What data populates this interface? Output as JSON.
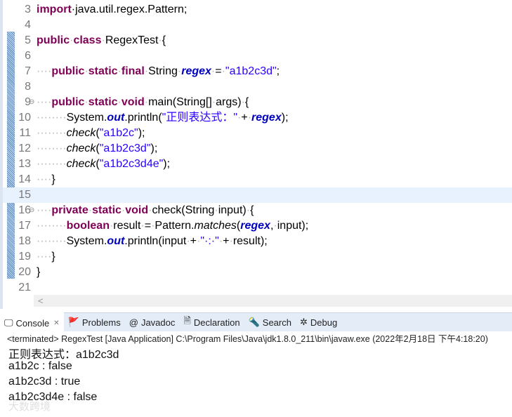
{
  "editor": {
    "current_line": 15,
    "lines": [
      {
        "n": "3",
        "tokens": [
          [
            "import",
            "kw"
          ],
          [
            "·",
            ""
          ],
          [
            "java.util.regex.Pattern;",
            ""
          ]
        ]
      },
      {
        "n": "4",
        "tokens": []
      },
      {
        "n": "5",
        "tokens": [
          [
            "public",
            "kw"
          ],
          [
            "·",
            "ws"
          ],
          [
            "class",
            "kw"
          ],
          [
            "·",
            "ws"
          ],
          [
            "RegexTest",
            ""
          ],
          [
            "·",
            "ws"
          ],
          [
            "{",
            ""
          ]
        ]
      },
      {
        "n": "6",
        "tokens": []
      },
      {
        "n": "7",
        "tokens": [
          [
            "····",
            "ws"
          ],
          [
            "public",
            "kw"
          ],
          [
            "·",
            "ws"
          ],
          [
            "static",
            "kw"
          ],
          [
            "·",
            "ws"
          ],
          [
            "final",
            "kw"
          ],
          [
            "·",
            "ws"
          ],
          [
            "String",
            ""
          ],
          [
            "·",
            "ws"
          ],
          [
            "regex",
            "fld"
          ],
          [
            "·",
            "ws"
          ],
          [
            "=",
            ""
          ],
          [
            "·",
            "ws"
          ],
          [
            "\"a1b2c3d\"",
            "str"
          ],
          [
            ";",
            ""
          ]
        ]
      },
      {
        "n": "8",
        "tokens": []
      },
      {
        "n": "9",
        "fold": true,
        "tokens": [
          [
            "····",
            "ws"
          ],
          [
            "public",
            "kw"
          ],
          [
            "·",
            "ws"
          ],
          [
            "static",
            "kw"
          ],
          [
            "·",
            "ws"
          ],
          [
            "void",
            "kw"
          ],
          [
            "·",
            "ws"
          ],
          [
            "main(String[]",
            ""
          ],
          [
            "·",
            "ws"
          ],
          [
            "args)",
            ""
          ],
          [
            "·",
            "ws"
          ],
          [
            "{",
            ""
          ]
        ]
      },
      {
        "n": "10",
        "tokens": [
          [
            "········",
            "ws"
          ],
          [
            "System.",
            ""
          ],
          [
            "out",
            "fld"
          ],
          [
            ".println(",
            ""
          ],
          [
            "\"正则表达式：\"",
            "str"
          ],
          [
            "·",
            "ws"
          ],
          [
            "+",
            ""
          ],
          [
            "·",
            "ws"
          ],
          [
            "regex",
            "fld"
          ],
          [
            ");",
            ""
          ]
        ]
      },
      {
        "n": "11",
        "tokens": [
          [
            "········",
            "ws"
          ],
          [
            "check",
            "it"
          ],
          [
            "(",
            ""
          ],
          [
            "\"a1b2c\"",
            "str"
          ],
          [
            ");",
            ""
          ]
        ]
      },
      {
        "n": "12",
        "tokens": [
          [
            "········",
            "ws"
          ],
          [
            "check",
            "it"
          ],
          [
            "(",
            ""
          ],
          [
            "\"a1b2c3d\"",
            "str"
          ],
          [
            ");",
            ""
          ]
        ]
      },
      {
        "n": "13",
        "tokens": [
          [
            "········",
            "ws"
          ],
          [
            "check",
            "it"
          ],
          [
            "(",
            ""
          ],
          [
            "\"a1b2c3d4e\"",
            "str"
          ],
          [
            ");",
            ""
          ]
        ]
      },
      {
        "n": "14",
        "tokens": [
          [
            "····",
            "ws"
          ],
          [
            "}",
            ""
          ]
        ]
      },
      {
        "n": "15",
        "tokens": []
      },
      {
        "n": "16",
        "fold": true,
        "tokens": [
          [
            "····",
            "ws"
          ],
          [
            "private",
            "kw"
          ],
          [
            "·",
            "ws"
          ],
          [
            "static",
            "kw"
          ],
          [
            "·",
            "ws"
          ],
          [
            "void",
            "kw"
          ],
          [
            "·",
            "ws"
          ],
          [
            "check(String",
            ""
          ],
          [
            "·",
            "ws"
          ],
          [
            "input)",
            ""
          ],
          [
            "·",
            "ws"
          ],
          [
            "{",
            ""
          ]
        ]
      },
      {
        "n": "17",
        "tokens": [
          [
            "········",
            "ws"
          ],
          [
            "boolean",
            "kw"
          ],
          [
            "·",
            "ws"
          ],
          [
            "result",
            ""
          ],
          [
            "·",
            "ws"
          ],
          [
            "=",
            ""
          ],
          [
            "·",
            "ws"
          ],
          [
            "Pattern.",
            ""
          ],
          [
            "matches",
            "it"
          ],
          [
            "(",
            ""
          ],
          [
            "regex",
            "fld"
          ],
          [
            ",",
            ""
          ],
          [
            "·",
            "ws"
          ],
          [
            "input);",
            ""
          ]
        ]
      },
      {
        "n": "18",
        "tokens": [
          [
            "········",
            "ws"
          ],
          [
            "System.",
            ""
          ],
          [
            "out",
            "fld"
          ],
          [
            ".println(input",
            ""
          ],
          [
            "·",
            "ws"
          ],
          [
            "+",
            ""
          ],
          [
            "·",
            "ws"
          ],
          [
            "\"·:·\"",
            "str"
          ],
          [
            "·",
            "ws"
          ],
          [
            "+",
            ""
          ],
          [
            "·",
            "ws"
          ],
          [
            "result);",
            ""
          ]
        ]
      },
      {
        "n": "19",
        "tokens": [
          [
            "····",
            "ws"
          ],
          [
            "}",
            ""
          ]
        ]
      },
      {
        "n": "20",
        "tokens": [
          [
            "}",
            ""
          ]
        ]
      },
      {
        "n": "21",
        "tokens": []
      }
    ],
    "hscroll_arrow": "<"
  },
  "tabs": [
    {
      "label": "Console",
      "icon": "console-icon",
      "glyph": "🖵",
      "active": true,
      "close": "✕"
    },
    {
      "label": "Problems",
      "icon": "problems-icon",
      "glyph": "🚩"
    },
    {
      "label": "Javadoc",
      "icon": "at-icon",
      "glyph": "@"
    },
    {
      "label": "Declaration",
      "icon": "declaration-icon",
      "glyph": "🗎"
    },
    {
      "label": "Search",
      "icon": "search-icon",
      "glyph": "🔦"
    },
    {
      "label": "Debug",
      "icon": "bug-icon",
      "glyph": "✲"
    }
  ],
  "console": {
    "header": "<terminated> RegexTest [Java Application] C:\\Program Files\\Java\\jdk1.8.0_211\\bin\\javaw.exe (2022年2月18日 下午4:18:20)",
    "output": [
      "正则表达式：a1b2c3d",
      "a1b2c : false",
      "a1b2c3d : true",
      "a1b2c3d4e : false"
    ]
  },
  "watermark": "大数跨境"
}
